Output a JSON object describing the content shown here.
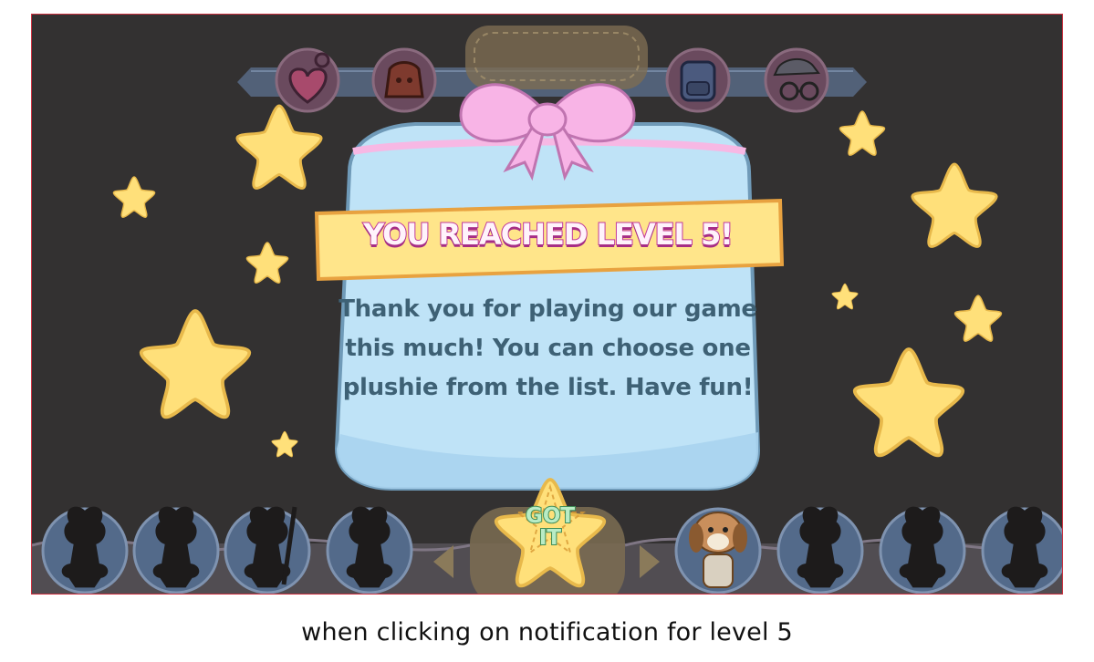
{
  "popup": {
    "title": "YOU REACHED LEVEL 5!",
    "body": "Thank you for playing our game this much! You can choose one plushie from the list. Have fun!",
    "button_label": "GOT IT"
  },
  "top_icons": [
    "heart-keychain-icon",
    "backpack-red-icon",
    "backpack-blue-icon",
    "glasses-hat-icon"
  ],
  "plushie_slots": [
    "silhouette",
    "silhouette",
    "silhouette",
    "silhouette",
    "dog-plushie",
    "silhouette",
    "silhouette",
    "silhouette"
  ],
  "caption": "when clicking on notification for level 5",
  "colors": {
    "background": "#333131",
    "star": "#ffe07a",
    "popup_fill": "#bfe3f7",
    "banner": "#ffe58a",
    "bow": "#f8b4e6",
    "text": "#3e6175",
    "frame_border": "#c9303f"
  }
}
